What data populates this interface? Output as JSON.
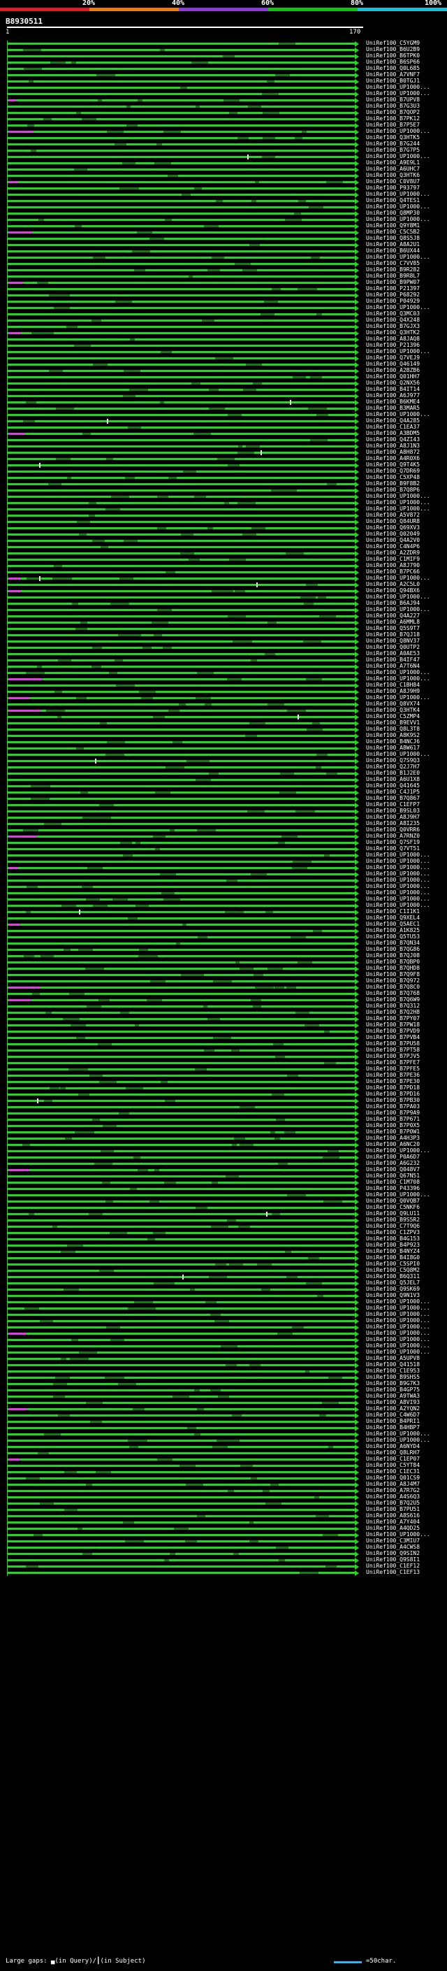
{
  "identity_scale": {
    "labels": [
      "20%",
      "40%",
      "60%",
      "80%",
      "100%"
    ],
    "colors": [
      "#e01b24",
      "#e87d0d",
      "#8e3bd6",
      "#12c212",
      "#17c2d6"
    ]
  },
  "query_id": "B8930511",
  "ruler": {
    "start": "1",
    "end": "170"
  },
  "hits": [
    "UniRef100_C5YGM9",
    "UniRef100_B6U2B9",
    "UniRef100_B6TPK0",
    "UniRef100_B6SP66",
    "UniRef100_Q0L685",
    "UniRef100_A7VNF7",
    "UniRef100_B0TGJ1",
    "UniRef100_UP1000...",
    "UniRef100_UP1000...",
    "UniRef100_B7UPV8",
    "UniRef100_B7G3U3",
    "UniRef100_B7QOP2",
    "UniRef100_B7PK12",
    "UniRef100_B7P5E7",
    "UniRef100_UP1000...",
    "UniRef100_Q3HTK5",
    "UniRef100_B7G244",
    "UniRef100_B7G7P5",
    "UniRef100_UP1000...",
    "UniRef100_A9E9L1",
    "UniRef100_A6UHC7",
    "UniRef100_Q3HTK6",
    "UniRef100_C0V8U7",
    "UniRef100_P93797",
    "UniRef100_UP1000...",
    "UniRef100_Q4TES1",
    "UniRef100_UP1000...",
    "UniRef100_Q8MP30",
    "UniRef100_UP1000...",
    "UniRef100_Q9Y8M1",
    "UniRef100_C5C5B2",
    "UniRef100_Q8S5J8",
    "UniRef100_A8A2U1",
    "UniRef100_B6UX44",
    "UniRef100_UP1000...",
    "UniRef100_C7VV85",
    "UniRef100_B9R282",
    "UniRef100_B9R8L7",
    "UniRef100_B9PW07",
    "UniRef100_P21397",
    "UniRef100_P68292",
    "UniRef100_P04929",
    "UniRef100_UP1000...",
    "UniRef100_Q3MC03",
    "UniRef100_Q4X248",
    "UniRef100_B7GJX3",
    "UniRef100_Q3HTK2",
    "UniRef100_A8JAQ8",
    "UniRef100_P21396",
    "UniRef100_UP1000...",
    "UniRef100_Q7VEJ9",
    "UniRef100_Q46149",
    "UniRef100_A2BZB6",
    "UniRef100_Q01HH7",
    "UniRef100_Q2NX56",
    "UniRef100_B4IT14",
    "UniRef100_A6J977",
    "UniRef100_B6KME4",
    "UniRef100_B3MAR5",
    "UniRef100_UP1000...",
    "UniRef100_Q4A285",
    "UniRef100_C1EA37",
    "UniRef100_A3BDM5",
    "UniRef100_Q4ZI43",
    "UniRef100_A8J1N3",
    "UniRef100_A8H872",
    "UniRef100_A4R0X6",
    "UniRef100_Q9T4K5",
    "UniRef100_Q7DR69",
    "UniRef100_C5XP48",
    "UniRef100_B9F8B2",
    "UniRef100_B7Q8P6",
    "UniRef100_UP1000...",
    "UniRef100_UP1000...",
    "UniRef100_UP1000...",
    "UniRef100_A5V872",
    "UniRef100_Q84UR8",
    "UniRef100_Q69XV3",
    "UniRef100_Q02049",
    "UniRef100_Q4A2V0",
    "UniRef100_C4N4P6",
    "UniRef100_A2ZDR9",
    "UniRef100_C1MIF9",
    "UniRef100_A8J790",
    "UniRef100_B7PC66",
    "UniRef100_UP1000...",
    "UniRef100_A2C5L0",
    "UniRef100_Q94BX6",
    "UniRef100_UP1000...",
    "UniRef100_B6AJ94",
    "UniRef100_UP1000...",
    "UniRef100_Q4A227",
    "UniRef100_A6MML8",
    "UniRef100_Q5S9T7",
    "UniRef100_B7QJ18",
    "UniRef100_Q8NV37",
    "UniRef100_Q0UTP2",
    "UniRef100_A0AE53",
    "UniRef100_B4IF47",
    "UniRef100_A7T6N4",
    "UniRef100_UP1000...",
    "UniRef100_UP1000...",
    "UniRef100_C1BH84",
    "UniRef100_A8J9H9",
    "UniRef100_UP1000...",
    "UniRef100_Q8VX74",
    "UniRef100_Q3HTK4",
    "UniRef100_C5ZMP4",
    "UniRef100_B9EVV1",
    "UniRef100_Q8L3T8",
    "UniRef100_A8K9S2",
    "UniRef100_B4NCJ6",
    "UniRef100_A8W617",
    "UniRef100_UP1000...",
    "UniRef100_Q7S9Q3",
    "UniRef100_Q2J7H7",
    "UniRef100_B1J2E0",
    "UniRef100_A6U1X8",
    "UniRef100_Q41645",
    "UniRef100_C4J1P5",
    "UniRef100_B7Q867",
    "UniRef100_C1EFP7",
    "UniRef100_B9SL03",
    "UniRef100_A8J9H7",
    "UniRef100_A8I235",
    "UniRef100_Q0VRR6",
    "UniRef100_A7RNZ0",
    "UniRef100_Q7SF19",
    "UniRef100_Q7VT51",
    "UniRef100_UP1000...",
    "UniRef100_UP1000...",
    "UniRef100_UP1000...",
    "UniRef100_UP1000...",
    "UniRef100_UP1000...",
    "UniRef100_UP1000...",
    "UniRef100_UP1000...",
    "UniRef100_UP1000...",
    "UniRef100_UP1000...",
    "UniRef100_C1I1K1",
    "UniRef100_Q9XEL4",
    "UniRef100_Q5AEC1",
    "UniRef100_A1K825",
    "UniRef100_Q5TU53",
    "UniRef100_B7QN34",
    "UniRef100_B7QG86",
    "UniRef100_B7QJ08",
    "UniRef100_B7QBP0",
    "UniRef100_B7QHD8",
    "UniRef100_B7Q9F8",
    "UniRef100_B7Q972",
    "UniRef100_B7Q8C0",
    "UniRef100_B7Q768",
    "UniRef100_B7Q6W9",
    "UniRef100_B7Q312",
    "UniRef100_B7Q2H8",
    "UniRef100_B7PY07",
    "UniRef100_B7PW18",
    "UniRef100_B7PVD9",
    "UniRef100_B7PVB4",
    "UniRef100_B7PU58",
    "UniRef100_B7PT58",
    "UniRef100_B7PJV5",
    "UniRef100_B7PFE7",
    "UniRef100_B7PFE5",
    "UniRef100_B7PE36",
    "UniRef100_B7PE30",
    "UniRef100_B7PD18",
    "UniRef100_B7PD16",
    "UniRef100_B7PB30",
    "UniRef100_B7PA03",
    "UniRef100_B7P9A9",
    "UniRef100_B7P671",
    "UniRef100_B7P0X5",
    "UniRef100_B7P0W1",
    "UniRef100_A4H3P3",
    "UniRef100_A6NC20",
    "UniRef100_UP1000...",
    "UniRef100_P0A6D7",
    "UniRef100_A6G232",
    "UniRef100_Q048V7",
    "UniRef100_Q67N51",
    "UniRef100_C1M708",
    "UniRef100_P43396",
    "UniRef100_UP1000...",
    "UniRef100_Q0VQB7",
    "UniRef100_C5NKF6",
    "UniRef100_Q9LU11",
    "UniRef100_B9S5R2",
    "UniRef100_C7T9Q6",
    "UniRef100_C1ZPV3",
    "UniRef100_B4G153",
    "UniRef100_B4P923",
    "UniRef100_B4NYZ4",
    "UniRef100_B4I8G0",
    "UniRef100_C5SPI0",
    "UniRef100_C5Q8M2",
    "UniRef100_B6Q311",
    "UniRef100_Q5JEL7",
    "UniRef100_Q9SK69",
    "UniRef100_Q9N1V3",
    "UniRef100_UP1000...",
    "UniRef100_UP1000...",
    "UniRef100_UP1000...",
    "UniRef100_UP1000...",
    "UniRef100_UP1000...",
    "UniRef100_UP1000...",
    "UniRef100_UP1000...",
    "UniRef100_UP1000...",
    "UniRef100_UP1000...",
    "UniRef100_A5UPV8",
    "UniRef100_Q41518",
    "UniRef100_C1E953",
    "UniRef100_B9SHS5",
    "UniRef100_B9G7K3",
    "UniRef100_B4GP75",
    "UniRef100_A9TWA3",
    "UniRef100_A8VI93",
    "UniRef100_A2YQN2",
    "UniRef100_C4W6D7",
    "UniRef100_B4PRI1",
    "UniRef100_B4HBP7",
    "UniRef100_UP1000...",
    "UniRef100_UP1000...",
    "UniRef100_A6NYD4",
    "UniRef100_Q8LRH7",
    "UniRef100_C1EP07",
    "UniRef100_C5YT84",
    "UniRef100_C1EC31",
    "UniRef100_Q01CS9",
    "UniRef100_A8J4M7",
    "UniRef100_A7R7G2",
    "UniRef100_A4S6Q3",
    "UniRef100_B7Q2U5",
    "UniRef100_B7PU51",
    "UniRef100_A8S616",
    "UniRef100_A7Y404",
    "UniRef100_A4QD25",
    "UniRef100_UP1000...",
    "UniRef100_C3MIU7",
    "UniRef100_A4CWS8",
    "UniRef100_Q9SIN2",
    "UniRef100_Q9S8I1",
    "UniRef100_C1EF12",
    "UniRef100_C1EF13"
  ],
  "footer": {
    "large_gaps": "Large gaps: ▄(in Query)/┃(in Subject)",
    "scale": "=50char."
  }
}
